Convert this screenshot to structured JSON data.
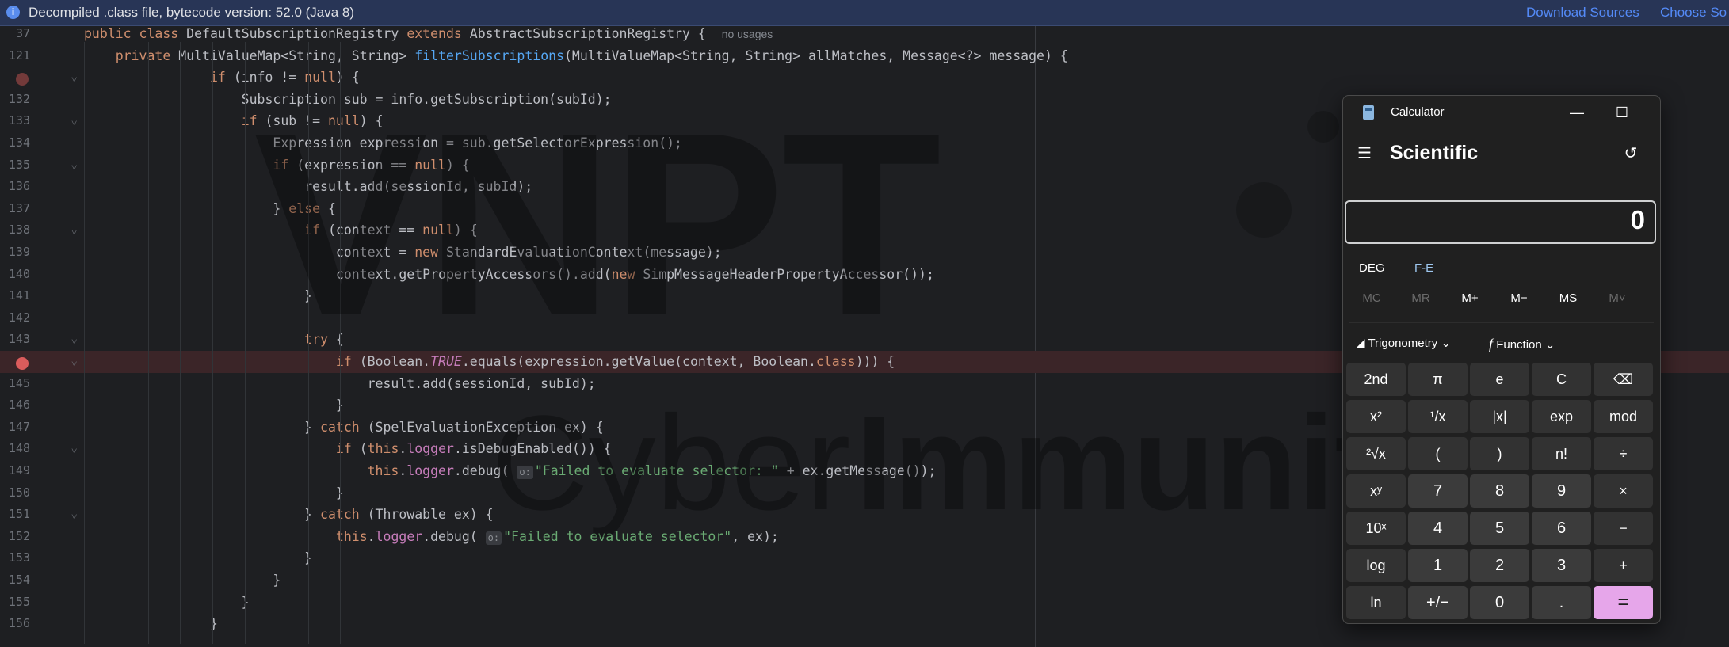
{
  "banner": {
    "message": "Decompiled .class file, bytecode version: 52.0 (Java 8)",
    "download_sources": "Download Sources",
    "choose_sources": "Choose So"
  },
  "editor": {
    "lines": [
      {
        "no": "37",
        "html": "<span class='kw'>public class</span> DefaultSubscriptionRegistry <span class='kw'>extends</span> AbstractSubscriptionRegistry {  <span class='hint'>no usages</span>",
        "indent": 0
      },
      {
        "no": "121",
        "html": "    <span class='kw'>private</span> MultiValueMap&lt;String, String&gt; <span class='fn'>filterSubscriptions</span>(MultiValueMap&lt;String, String&gt; allMatches, Message&lt;?&gt; message) {",
        "indent": 0
      },
      {
        "no": "",
        "html": "                <span class='kw'>if</span> (info != <span class='kw'>null</span>) {",
        "indent": 0,
        "gutter": "bp-dim",
        "fold": true
      },
      {
        "no": "132",
        "html": "                    Subscription sub = info.getSubscription(subId);",
        "indent": 0
      },
      {
        "no": "133",
        "html": "                    <span class='kw'>if</span> (sub != <span class='kw'>null</span>) {",
        "indent": 0,
        "fold": true
      },
      {
        "no": "134",
        "html": "                        Expression expression = sub.getSelectorExpression();",
        "indent": 0
      },
      {
        "no": "135",
        "html": "                        <span class='kw'>if</span> (expression == <span class='kw'>null</span>) {",
        "indent": 0,
        "fold": true
      },
      {
        "no": "136",
        "html": "                            result.add(sessionId, subId);",
        "indent": 0
      },
      {
        "no": "137",
        "html": "                        } <span class='kw'>else</span> {",
        "indent": 0
      },
      {
        "no": "138",
        "html": "                            <span class='kw'>if</span> (context == <span class='kw'>null</span>) {",
        "indent": 0,
        "fold": true
      },
      {
        "no": "139",
        "html": "                                context = <span class='kw'>new</span> StandardEvaluationContext(message);",
        "indent": 0
      },
      {
        "no": "140",
        "html": "                                context.getPropertyAccessors().add(<span class='kw'>new</span> SimpMessageHeaderPropertyAccessor());",
        "indent": 0
      },
      {
        "no": "141",
        "html": "                            }",
        "indent": 0
      },
      {
        "no": "142",
        "html": "",
        "indent": 0
      },
      {
        "no": "143",
        "html": "                            <span class='kw'>try</span> {",
        "indent": 0,
        "fold": true
      },
      {
        "no": "",
        "html": "                                <span class='kw'>if</span> (Boolean.<span class='it'>TRUE</span>.equals(expression.getValue(context, Boolean.<span class='kw'>class</span>))) {",
        "indent": 0,
        "gutter": "bp",
        "fold": true,
        "hl": true
      },
      {
        "no": "145",
        "html": "                                    result.add(sessionId, subId);",
        "indent": 0
      },
      {
        "no": "146",
        "html": "                                }",
        "indent": 0
      },
      {
        "no": "147",
        "html": "                            } <span class='kw'>catch</span> (SpelEvaluationException ex) {",
        "indent": 0
      },
      {
        "no": "148",
        "html": "                                <span class='kw'>if</span> (<span class='kw'>this</span>.<span class='fld'>logger</span>.isDebugEnabled()) {",
        "indent": 0,
        "fold": true
      },
      {
        "no": "149",
        "html": "                                    <span class='kw'>this</span>.<span class='fld'>logger</span>.debug( <span class='pbadge'>o:</span><span class='str'>\"Failed to evaluate selector: \"</span> + ex.getMessage());",
        "indent": 0
      },
      {
        "no": "150",
        "html": "                                }",
        "indent": 0
      },
      {
        "no": "151",
        "html": "                            } <span class='kw'>catch</span> (Throwable ex) {",
        "indent": 0,
        "fold": true
      },
      {
        "no": "152",
        "html": "                                <span class='kw'>this</span>.<span class='fld'>logger</span>.debug( <span class='pbadge'>o:</span><span class='str'>\"Failed to evaluate selector\"</span>, ex);",
        "indent": 0
      },
      {
        "no": "153",
        "html": "                            }",
        "indent": 0
      },
      {
        "no": "154",
        "html": "                        }",
        "indent": 0
      },
      {
        "no": "155",
        "html": "                    }",
        "indent": 0
      },
      {
        "no": "156",
        "html": "                }",
        "indent": 0
      }
    ]
  },
  "watermark": {
    "brand": "VNPT",
    "cyber": "Cyber",
    "immunity": "Immunity"
  },
  "calculator": {
    "title": "Calculator",
    "mode": "Scientific",
    "display": "0",
    "deg": "DEG",
    "fe": "F-E",
    "memory": [
      "MC",
      "MR",
      "M+",
      "M−",
      "MS",
      "M˅"
    ],
    "trigonometry": "Trigonometry",
    "function": "Function",
    "keys": [
      [
        "2nd",
        "π",
        "e",
        "C",
        "⌫"
      ],
      [
        "x²",
        "¹/x",
        "|x|",
        "exp",
        "mod"
      ],
      [
        "²√x",
        "(",
        ")",
        "n!",
        "÷"
      ],
      [
        "xʸ",
        "7",
        "8",
        "9",
        "×"
      ],
      [
        "10ˣ",
        "4",
        "5",
        "6",
        "−"
      ],
      [
        "log",
        "1",
        "2",
        "3",
        "+"
      ],
      [
        "ln",
        "+/−",
        "0",
        ".",
        "="
      ]
    ]
  }
}
